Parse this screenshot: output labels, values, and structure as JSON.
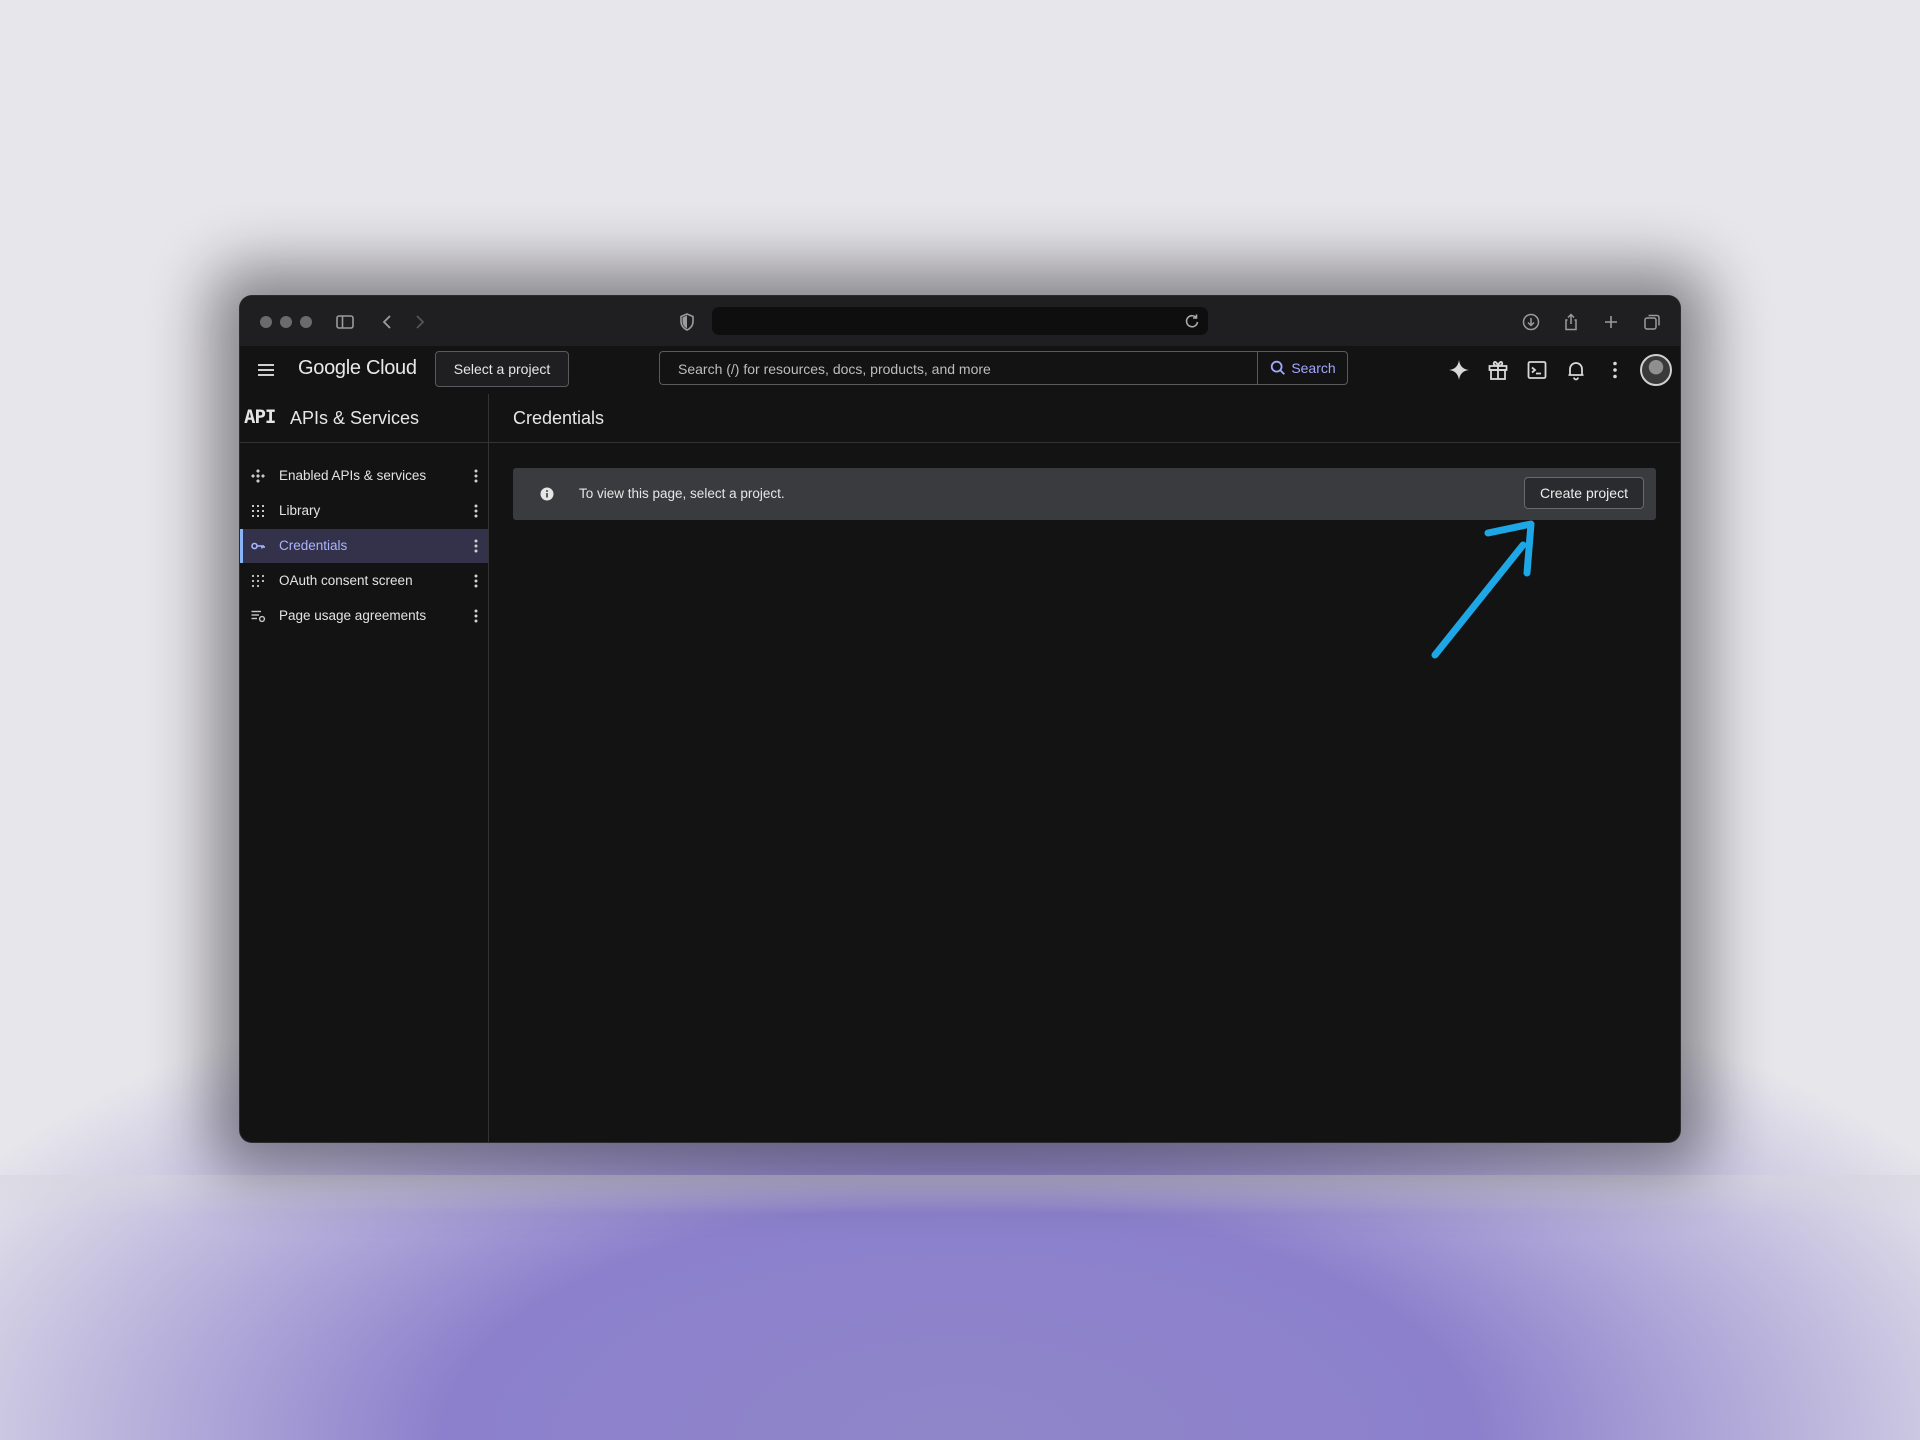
{
  "browser": {
    "url": "",
    "icons": [
      "sidebar-toggle-icon",
      "back-icon",
      "forward-icon",
      "shield-icon",
      "refresh-icon",
      "download-icon",
      "share-icon",
      "new-tab-icon",
      "tabs-overview-icon"
    ]
  },
  "header": {
    "logo": "Google Cloud",
    "project_button": "Select a project",
    "search_placeholder": "Search (/) for resources, docs, products, and more",
    "search_button": "Search",
    "icons": [
      "gemini-icon",
      "gift-icon",
      "cloud-shell-icon",
      "notifications-icon",
      "more-vert-icon",
      "avatar"
    ]
  },
  "sidebar": {
    "badge": "API",
    "title": "APIs & Services",
    "items": [
      {
        "label": "Enabled APIs & services",
        "icon": "enabled-apis-icon",
        "active": false
      },
      {
        "label": "Library",
        "icon": "library-icon",
        "active": false
      },
      {
        "label": "Credentials",
        "icon": "key-icon",
        "active": true
      },
      {
        "label": "OAuth consent screen",
        "icon": "oauth-icon",
        "active": false
      },
      {
        "label": "Page usage agreements",
        "icon": "agreements-icon",
        "active": false
      }
    ]
  },
  "main": {
    "title": "Credentials",
    "banner_text": "To view this page, select a project.",
    "create_button": "Create project"
  },
  "colors": {
    "accent": "#a9b4ff",
    "annotation_arrow": "#1ea7e6",
    "background": "#131313"
  }
}
